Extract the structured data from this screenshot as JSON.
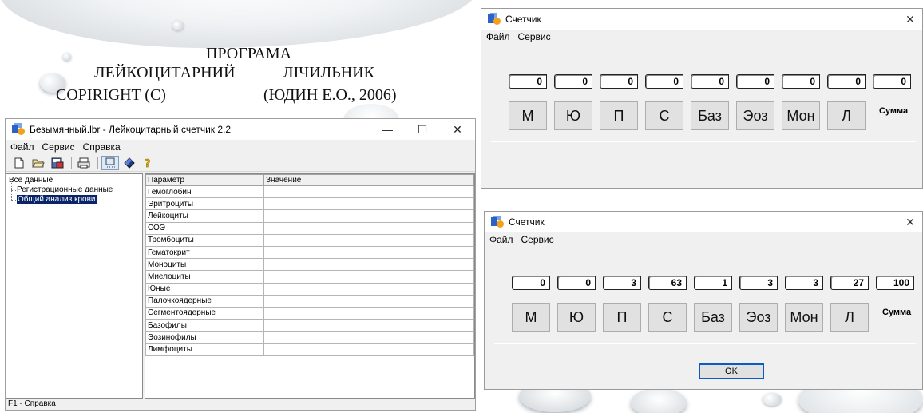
{
  "title_block": {
    "line1": "ПРОГРАМА",
    "line2a": "ЛЕЙКОЦИТАРНИЙ",
    "line2b": "ЛІЧИЛЬНИК",
    "line3a": "COPIRIGHT (C)",
    "line3b": "(ЮДИН Е.О., 2006)"
  },
  "main_window": {
    "title": "Безымянный.lbr - Лейкоцитарный счетчик 2.2",
    "controls": {
      "minimize": "—",
      "maximize": "☐",
      "close": "✕"
    },
    "menu": [
      "Файл",
      "Сервис",
      "Справка"
    ],
    "toolbar_icons": [
      "new-file-icon",
      "open-folder-icon",
      "save-icon",
      "print-icon",
      "counter-icon",
      "diamond-icon",
      "help-icon"
    ],
    "tree": {
      "root": "Все данные",
      "children": [
        "Регистрационные данные",
        "Общий анализ крови"
      ],
      "selected": "Общий анализ крови"
    },
    "table": {
      "headers": [
        "Параметр",
        "Значение"
      ],
      "rows": [
        "Гемоглобин",
        "Эритроциты",
        "Лейкоциты",
        "СОЭ",
        "Тромбоциты",
        "Гематокрит",
        "Моноциты",
        "Миелоциты",
        "Юные",
        "Палочкоядерные",
        "Сегментоядерные",
        "Базофилы",
        "Эозинофилы",
        "Лимфоциты"
      ]
    },
    "status": "F1 - Справка"
  },
  "counter1": {
    "title": "Счетчик",
    "menu": [
      "Файл",
      "Сервис"
    ],
    "values": [
      "0",
      "0",
      "0",
      "0",
      "0",
      "0",
      "0",
      "0",
      "0"
    ],
    "buttons": [
      "М",
      "Ю",
      "П",
      "С",
      "Баз",
      "Эоз",
      "Мон",
      "Л"
    ],
    "sum_label": "Сумма"
  },
  "counter2": {
    "title": "Счетчик",
    "menu": [
      "Файл",
      "Сервис"
    ],
    "values": [
      "0",
      "0",
      "3",
      "63",
      "1",
      "3",
      "3",
      "27",
      "100"
    ],
    "buttons": [
      "М",
      "Ю",
      "П",
      "С",
      "Баз",
      "Эоз",
      "Мон",
      "Л"
    ],
    "sum_label": "Сумма",
    "ok_label": "OK"
  },
  "colors": {
    "selection": "#0a246a",
    "ok_border": "#0a5bc2",
    "window_bg": "#f0f0f0"
  }
}
